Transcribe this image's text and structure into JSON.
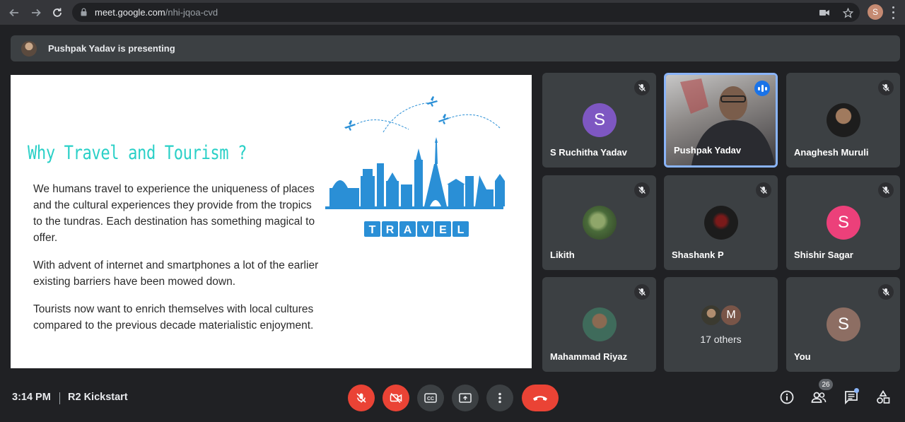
{
  "browser": {
    "url_domain": "meet.google.com",
    "url_path": "/nhi-jqoa-cvd",
    "profile_initial": "S"
  },
  "presenting": {
    "text": "Pushpak Yadav is presenting"
  },
  "slide": {
    "title": "Why Travel and Tourism ?",
    "paragraphs": [
      "We humans travel to experience the uniqueness of places and the cultural experiences they provide from the tropics to the tundras. Each destination has something magical to offer.",
      "With advent of internet and smartphones a lot of the earlier existing barriers have been mowed down.",
      "Tourists now want to  enrich themselves with local cultures compared to the previous decade materialistic enjoyment."
    ],
    "travel_word": "TRAVEL",
    "accent_color": "#2ad0c7",
    "art_color": "#2a8fd6"
  },
  "participants": [
    {
      "name": "S Ruchitha Yadav",
      "initial": "S",
      "avatar_color": "#7e57c2",
      "muted": true
    },
    {
      "name": "Pushpak Yadav",
      "initial": "",
      "avatar_color": "",
      "muted": false,
      "speaking": true
    },
    {
      "name": "Anaghesh Muruli",
      "initial": "",
      "avatar_color": "#1d1d1d",
      "muted": true
    },
    {
      "name": "Likith",
      "initial": "",
      "avatar_color": "#4a6b3a",
      "muted": true
    },
    {
      "name": "Shashank P",
      "initial": "",
      "avatar_color": "#1c1c1c",
      "muted": true
    },
    {
      "name": "Shishir Sagar",
      "initial": "S",
      "avatar_color": "#ec407a",
      "muted": true
    },
    {
      "name": "Mahammad Riyaz",
      "initial": "",
      "avatar_color": "#3f6b5b",
      "muted": true
    },
    {
      "name": "17 others",
      "initial": "M",
      "avatar_color": "#795548",
      "muted": false
    },
    {
      "name": "You",
      "initial": "S",
      "avatar_color": "#8d6e63",
      "muted": true
    }
  ],
  "bottom_bar": {
    "time": "3:14 PM",
    "meeting_name": "R2 Kickstart",
    "participant_count": "26",
    "end_call_color": "#ea4335"
  }
}
